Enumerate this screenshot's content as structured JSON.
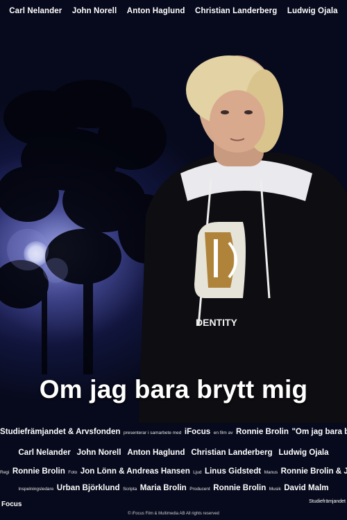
{
  "cast_top": [
    "Carl Nelander",
    "John Norell",
    "Anton Haglund",
    "Christian Landerberg",
    "Ludwig Ojala"
  ],
  "title": "Om jag bara brytt mig",
  "hoodie_text": "DENTITY",
  "credits": {
    "line1": {
      "part1": "Studiefrämjandet & Arvsfonden",
      "small1": "presenterar i samarbete med",
      "part2": "iFocus",
      "small2": "en film av",
      "part3": "Ronnie Brolin",
      "part4": "\"Om jag bara brytt mig\""
    },
    "cast": [
      "Carl Nelander",
      "John Norell",
      "Anton Haglund",
      "Christian Landerberg",
      "Ludwig Ojala"
    ],
    "line3": {
      "regi_label": "Regi",
      "regi": "Ronnie Brolin",
      "foto_label": "Foto",
      "foto": "Jon Lönn & Andreas Hansen",
      "ljud_label": "Ljud",
      "ljud": "Linus Gidstedt",
      "manus_label": "Manus",
      "manus": "Ronnie Brolin & Jenny Larsson"
    },
    "line4": {
      "insp_label": "Inspelningsledare",
      "insp": "Urban Björklund",
      "scripta_label": "Scripta",
      "scripta": "Maria Brolin",
      "prod_label": "Producent",
      "prod": "Ronnie Brolin",
      "musik_label": "Musik",
      "musik": "David Malm"
    }
  },
  "copyright": "© iFocus Film & Multimedia AB All rights reserved",
  "logo_left": "Focus",
  "logo_right": "Studiefrämjandet"
}
